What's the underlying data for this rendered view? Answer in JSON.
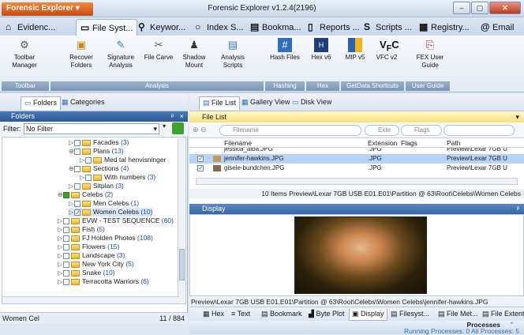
{
  "app": {
    "menu_button": "Forensic Explorer",
    "title": "Forensic Explorer v1.2.4(2196)"
  },
  "tabs": [
    {
      "label": "Evidenc...",
      "icon": "home-icon"
    },
    {
      "label": "File Syst...",
      "icon": "folder-icon"
    },
    {
      "label": "Keywor...",
      "icon": "keyword-search-icon"
    },
    {
      "label": "Index S...",
      "icon": "search-icon"
    },
    {
      "label": "Bookma...",
      "icon": "bookmark-icon"
    },
    {
      "label": "Reports ...",
      "icon": "report-icon"
    },
    {
      "label": "Scripts ...",
      "icon": "script-icon"
    },
    {
      "label": "Registry...",
      "icon": "registry-icon"
    },
    {
      "label": "Email",
      "icon": "email-icon"
    }
  ],
  "ribbon": {
    "buttons": [
      {
        "label": "Toolbar Manager",
        "icon": "gear-icon"
      },
      {
        "label": "Recover Folders",
        "icon": "recover-folder-icon"
      },
      {
        "label": "Signature Analysis",
        "icon": "signature-icon"
      },
      {
        "label": "File Carve",
        "icon": "carve-icon"
      },
      {
        "label": "Shadow Mount",
        "icon": "shadow-icon"
      },
      {
        "label": "Analysis Scripts",
        "icon": "analysis-script-icon"
      },
      {
        "label": "Hash Files",
        "icon": "hash-icon"
      },
      {
        "label": "Hex v6",
        "icon": "hex-icon"
      },
      {
        "label": "MIP v5",
        "icon": "mip-icon"
      },
      {
        "label": "VFC v2",
        "icon": "vfc-icon"
      },
      {
        "label": "FEX User Guide",
        "icon": "pdf-icon"
      }
    ],
    "groups": [
      "Toolbar",
      "Analysis",
      "Hashing",
      "Hex",
      "GetData Shortcuts",
      "User Guide"
    ]
  },
  "left": {
    "tabs": [
      "Folders",
      "Categories"
    ],
    "header": "Folders",
    "filter_label": "Filter:",
    "filter_value": "No Filter",
    "tree": [
      {
        "name": "Facades",
        "count": "(3)"
      },
      {
        "name": "Plans",
        "count": "(13)"
      },
      {
        "name": "Med tal henvisninger",
        "count": ""
      },
      {
        "name": "Sections",
        "count": "(4)"
      },
      {
        "name": "With numbers",
        "count": "(3)"
      },
      {
        "name": "Sitplan",
        "count": "(3)"
      },
      {
        "name": "Celebs",
        "count": "(2)"
      },
      {
        "name": "Men Celebs",
        "count": "(1)"
      },
      {
        "name": "Women Celebs",
        "count": "(10)"
      },
      {
        "name": "EVW - TEST SEQUENCE",
        "count": "(60)"
      },
      {
        "name": "Fish",
        "count": "(5)"
      },
      {
        "name": "FJ Holden Photos",
        "count": "(108)"
      },
      {
        "name": "Flowers",
        "count": "(15)"
      },
      {
        "name": "Landscape",
        "count": "(3)"
      },
      {
        "name": "New York City",
        "count": "(5)"
      },
      {
        "name": "Snake",
        "count": "(10)"
      },
      {
        "name": "Terracotta Warriors",
        "count": "(6)"
      }
    ],
    "status_name": "Women Cel",
    "status_count": "11 / 884"
  },
  "right": {
    "tabs": [
      "File List",
      "Gallery View",
      "Disk View"
    ],
    "list_header": "File List",
    "search": {
      "filename": "Filename",
      "ext": "Exte",
      "flags": "Flags"
    },
    "columns": {
      "filename": "Filename",
      "extension": "Extension",
      "flags": "Flags",
      "path": "Path"
    },
    "rows": [
      {
        "name": "jessica_alba.JPG",
        "ext": ".JPG",
        "path": "Preview\\Lexar 7GB U"
      },
      {
        "name": "jennifer-hawkins.JPG",
        "ext": ".JPG",
        "path": "Preview\\Lexar 7GB U"
      },
      {
        "name": "gisele-bundchen.JPG",
        "ext": ".JPG",
        "path": "Preview\\Lexar 7GB U"
      }
    ],
    "list_footer": "10 Items  Preview\\Lexar 7GB USB E01.E01\\Partition @ 63\\Root\\Celebs\\Women Celebs",
    "display_header": "Display",
    "display_path": "Preview\\Lexar 7GB USB E01.E01\\Partition @ 63\\Root\\Celebs\\Women Celebs\\jennifer-hawkins.JPG",
    "bottom_tabs": [
      "Hex",
      "Text",
      "Bookmark",
      "Byte Plot",
      "Display",
      "Filesyst...",
      "File Met...",
      "File Extent"
    ],
    "processes_title": "Processes",
    "processes_status": "Running Processes: 0   All Processes: 5"
  }
}
